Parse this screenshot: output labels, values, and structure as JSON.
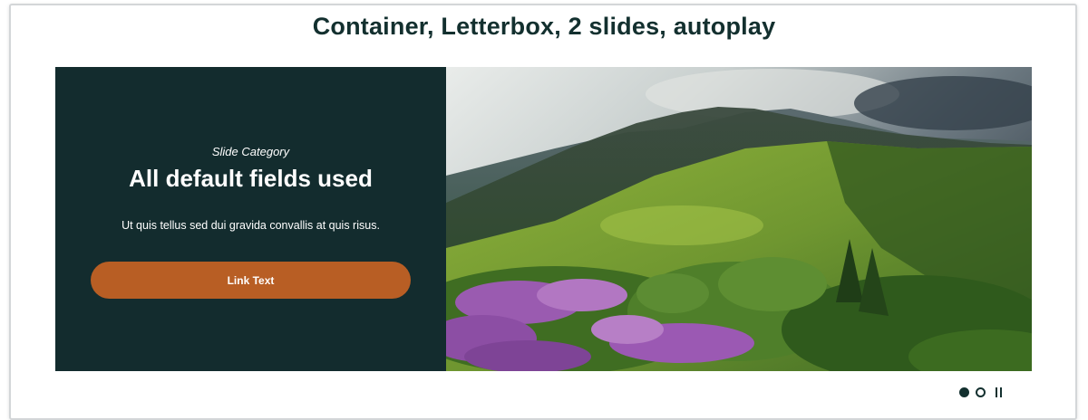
{
  "page": {
    "heading": "Container, Letterbox, 2 slides, autoplay"
  },
  "slide": {
    "category": "Slide Category",
    "title": "All default fields used",
    "body": "Ut quis tellus sed dui gravida convallis at quis risus.",
    "link_label": "Link Text",
    "image_subject": "mountain landscape with rhododendron flowers"
  },
  "carousel": {
    "slide_count": 2,
    "active_slide": 1,
    "autoplay": true,
    "indicator_icons": [
      "dot-filled-icon",
      "dot-outline-icon",
      "pause-icon"
    ]
  },
  "colors": {
    "heading": "#13302f",
    "panel": "#132c2e",
    "button": "#b85e24",
    "button_text": "#ffffff",
    "frame_border": "#d3d6d8"
  }
}
